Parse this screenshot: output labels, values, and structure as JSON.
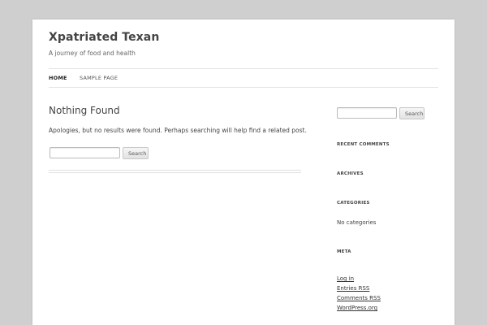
{
  "site": {
    "title": "Xpatriated Texan",
    "description": "A journey of food and health"
  },
  "nav": {
    "items": [
      {
        "label": "HOME",
        "active": true
      },
      {
        "label": "SAMPLE PAGE",
        "active": false
      }
    ]
  },
  "main": {
    "title": "Nothing Found",
    "message": "Apologies, but no results were found. Perhaps searching will help find a related post.",
    "search": {
      "value": "",
      "button_label": "Search"
    }
  },
  "sidebar": {
    "search": {
      "value": "",
      "button_label": "Search"
    },
    "widgets": {
      "recent_comments": {
        "title": "RECENT COMMENTS"
      },
      "archives": {
        "title": "ARCHIVES"
      },
      "categories": {
        "title": "CATEGORIES",
        "text": "No categories"
      },
      "meta": {
        "title": "META",
        "links": [
          "Log in",
          "Entries RSS",
          "Comments RSS",
          "WordPress.org"
        ]
      }
    }
  },
  "colors": {
    "background": "#cfcfcf",
    "page": "#ffffff",
    "text": "#444444"
  }
}
